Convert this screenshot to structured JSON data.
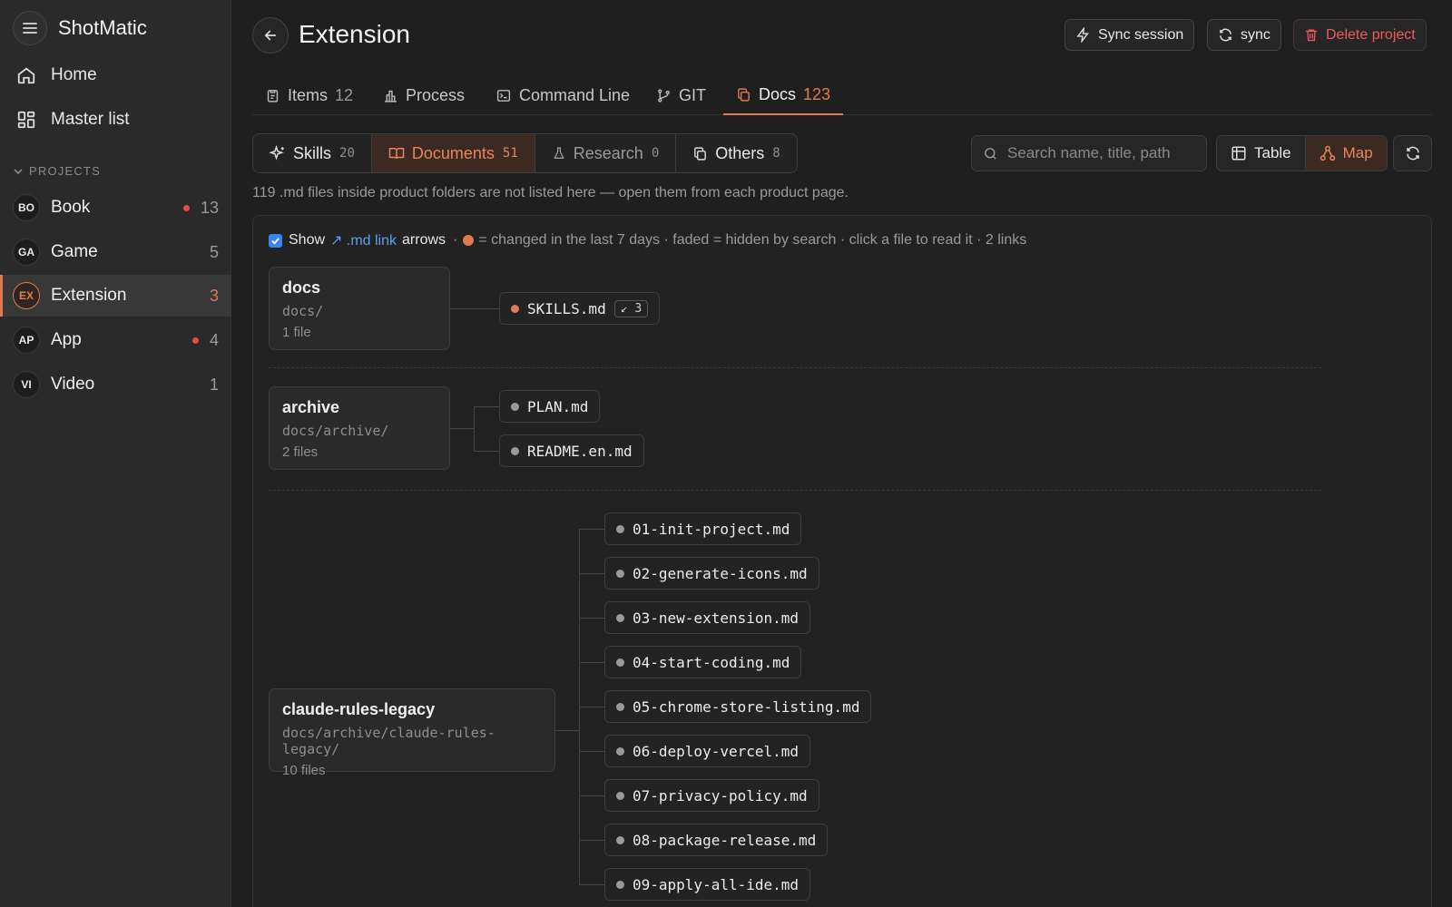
{
  "app": {
    "title": "ShotMatic"
  },
  "nav": [
    {
      "label": "Home",
      "icon": "home-icon"
    },
    {
      "label": "Master list",
      "icon": "grid-icon"
    }
  ],
  "projects_heading": "PROJECTS",
  "projects": [
    {
      "initials": "BO",
      "name": "Book",
      "count": "13",
      "dot": true,
      "active": false
    },
    {
      "initials": "GA",
      "name": "Game",
      "count": "5",
      "dot": false,
      "active": false
    },
    {
      "initials": "EX",
      "name": "Extension",
      "count": "3",
      "dot": false,
      "active": true
    },
    {
      "initials": "AP",
      "name": "App",
      "count": "4",
      "dot": true,
      "active": false
    },
    {
      "initials": "VI",
      "name": "Video",
      "count": "1",
      "dot": false,
      "active": false
    }
  ],
  "header": {
    "title": "Extension",
    "sync_session": "Sync session",
    "sync": "sync",
    "delete": "Delete project"
  },
  "tabs": [
    {
      "label": "Items",
      "count": "12"
    },
    {
      "label": "Process",
      "count": ""
    },
    {
      "label": "Command Line",
      "count": ""
    },
    {
      "label": "GIT",
      "count": ""
    },
    {
      "label": "Docs",
      "count": "123",
      "active": true
    }
  ],
  "segments": [
    {
      "label": "Skills",
      "count": "20"
    },
    {
      "label": "Documents",
      "count": "51",
      "active": true
    },
    {
      "label": "Research",
      "count": "0"
    },
    {
      "label": "Others",
      "count": "8"
    }
  ],
  "search": {
    "placeholder": "Search name, title, path"
  },
  "view": {
    "table": "Table",
    "map": "Map",
    "selected": "Map"
  },
  "note": "119 .md files inside product folders are not listed here — open them from each product page.",
  "legend": {
    "show": "Show",
    "link": "↗ .md link",
    "arrows": "arrows",
    "sep": "·",
    "text": "= changed in the last 7 days · faded = hidden by search · click a file to read it  · 2 links",
    "checked": true
  },
  "groups": [
    {
      "name": "docs",
      "path": "docs/",
      "count": "1 file",
      "files": [
        {
          "name": "SKILLS.md",
          "changed": true,
          "links": "↙ 3"
        }
      ]
    },
    {
      "name": "archive",
      "path": "docs/archive/",
      "count": "2 files",
      "files": [
        {
          "name": "PLAN.md",
          "changed": false
        },
        {
          "name": "README.en.md",
          "changed": false
        }
      ]
    },
    {
      "name": "claude-rules-legacy",
      "path": "docs/archive/claude-rules-legacy/",
      "count": "10 files",
      "files": [
        {
          "name": "01-init-project.md",
          "changed": false
        },
        {
          "name": "02-generate-icons.md",
          "changed": false
        },
        {
          "name": "03-new-extension.md",
          "changed": false
        },
        {
          "name": "04-start-coding.md",
          "changed": false
        },
        {
          "name": "05-chrome-store-listing.md",
          "changed": false
        },
        {
          "name": "06-deploy-vercel.md",
          "changed": false
        },
        {
          "name": "07-privacy-policy.md",
          "changed": false
        },
        {
          "name": "08-package-release.md",
          "changed": false
        },
        {
          "name": "09-apply-all-ide.md",
          "changed": false
        }
      ]
    }
  ],
  "colors": {
    "accent": "#e07b4f",
    "link": "#5aa0f0",
    "danger": "#ef5b5b"
  }
}
